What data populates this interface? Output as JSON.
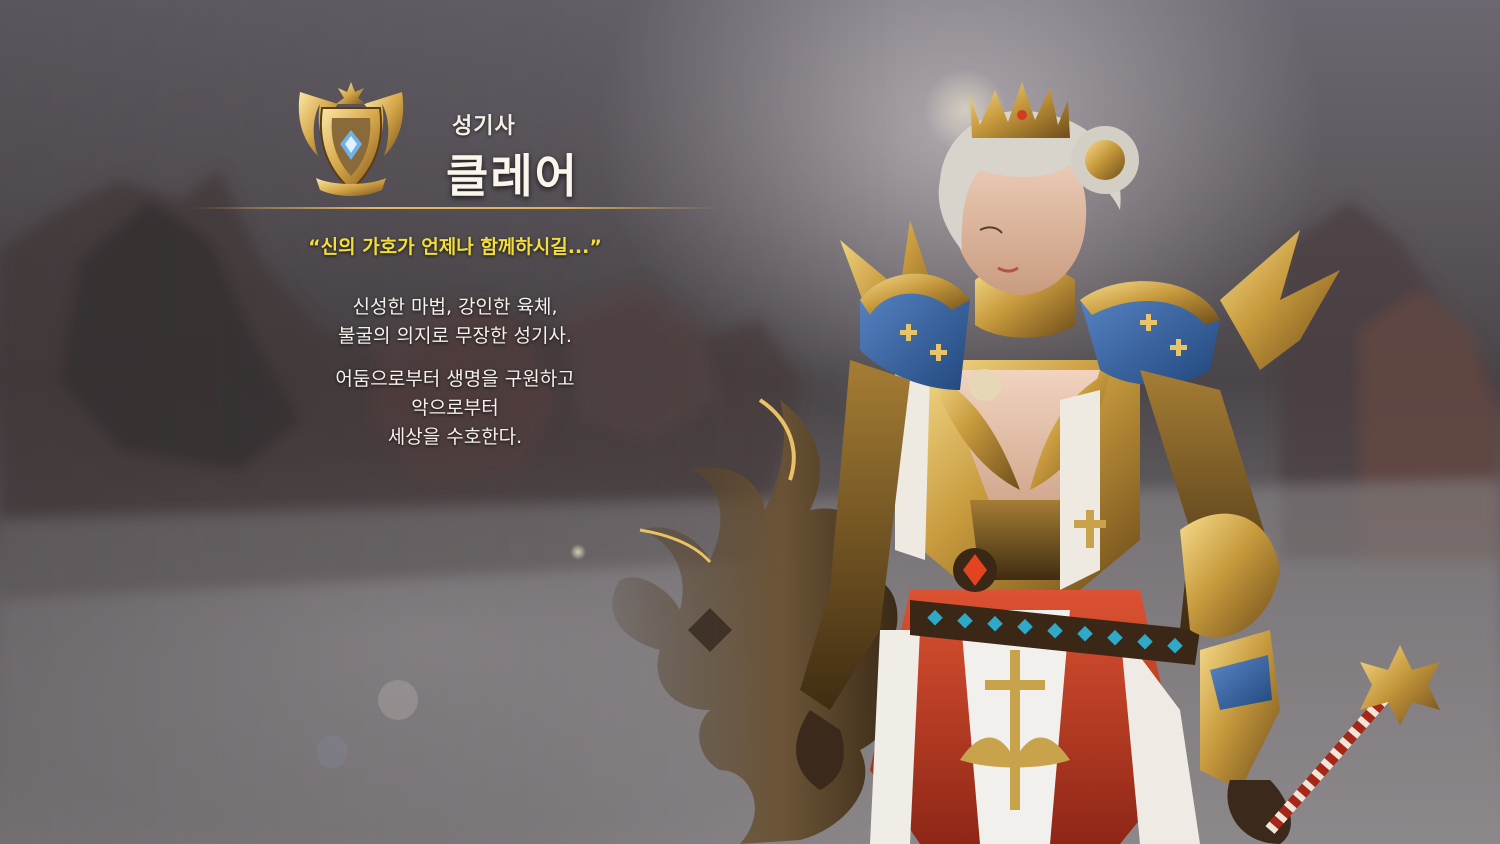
{
  "header": {
    "class_name": "성기사",
    "character_name": "클레어"
  },
  "description": {
    "quote": "“신의 가호가 언제나 함께하시길...”",
    "paragraph1": [
      "신성한 마법, 강인한 육체,",
      "불굴의 의지로 무장한 성기사."
    ],
    "paragraph2": [
      "어둠으로부터 생명을 구원하고",
      "악으로부터",
      "세상을 수호한다."
    ]
  },
  "colors": {
    "quote_text": "#f3dd3a",
    "body_text": "#f5f1ec",
    "gold_accent": "#d8a94f",
    "armor_blue": "#2f5f9e",
    "cloth_red": "#c6402a"
  },
  "icons": {
    "class_emblem": "winged-gold-crest-icon"
  }
}
